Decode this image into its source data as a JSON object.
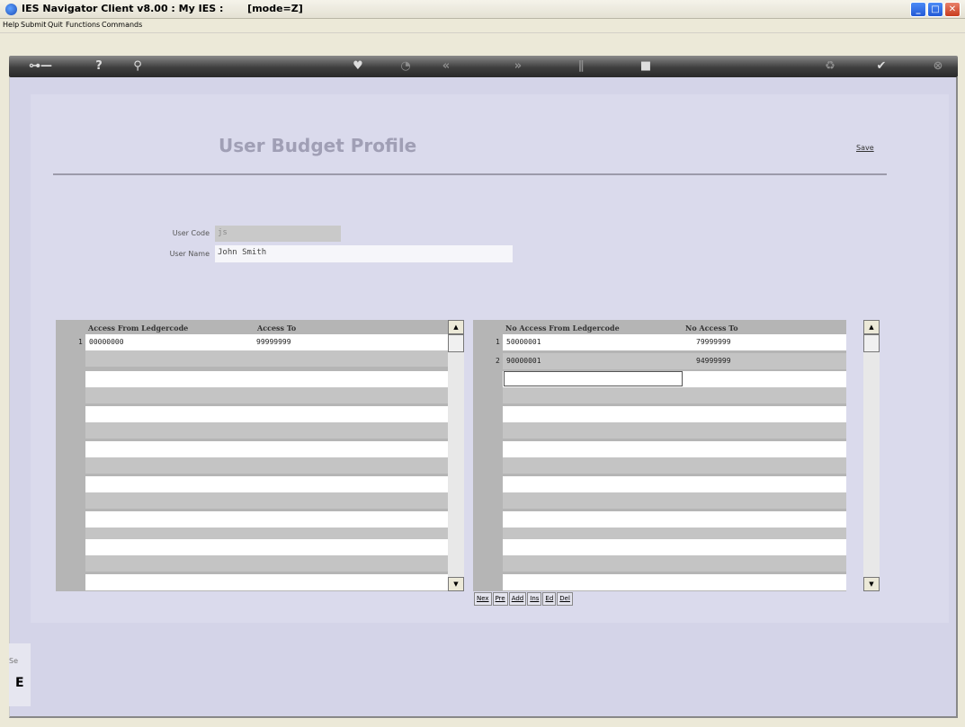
{
  "window": {
    "title": "IES Navigator Client v8.00 : My IES :       [mode=Z]"
  },
  "menu": {
    "items": [
      "Help",
      "Submit",
      "Quit",
      "Functions",
      "Commands"
    ]
  },
  "toolbar": {
    "icons": [
      "key-icon",
      "help-icon",
      "search-icon",
      "heart-icon",
      "history-icon",
      "rewind-icon",
      "fast-forward-icon",
      "pause-icon",
      "stop-icon",
      "recycle-icon",
      "check-icon",
      "close-icon"
    ]
  },
  "form": {
    "title": "User Budget Profile",
    "save_label": "Save",
    "user_code_label": "User Code",
    "user_code_value": "js",
    "user_name_label": "User Name",
    "user_name_value": "John Smith"
  },
  "access_grid": {
    "col1_header": "Access From Ledgercode",
    "col2_header": "Access To",
    "rows": [
      {
        "num": "1",
        "from": "00000000",
        "to": "99999999"
      }
    ]
  },
  "no_access_grid": {
    "col1_header": "No Access From Ledgercode",
    "col2_header": "No Access To",
    "rows": [
      {
        "num": "1",
        "from": "50000001",
        "to": "79999999"
      },
      {
        "num": "2",
        "from": "90000001",
        "to": "94999999"
      }
    ]
  },
  "nav_buttons": [
    "Nex",
    "Pre",
    "Add",
    "Ins",
    "Ed",
    "Del"
  ],
  "side": {
    "label": "Se",
    "char": "E"
  }
}
